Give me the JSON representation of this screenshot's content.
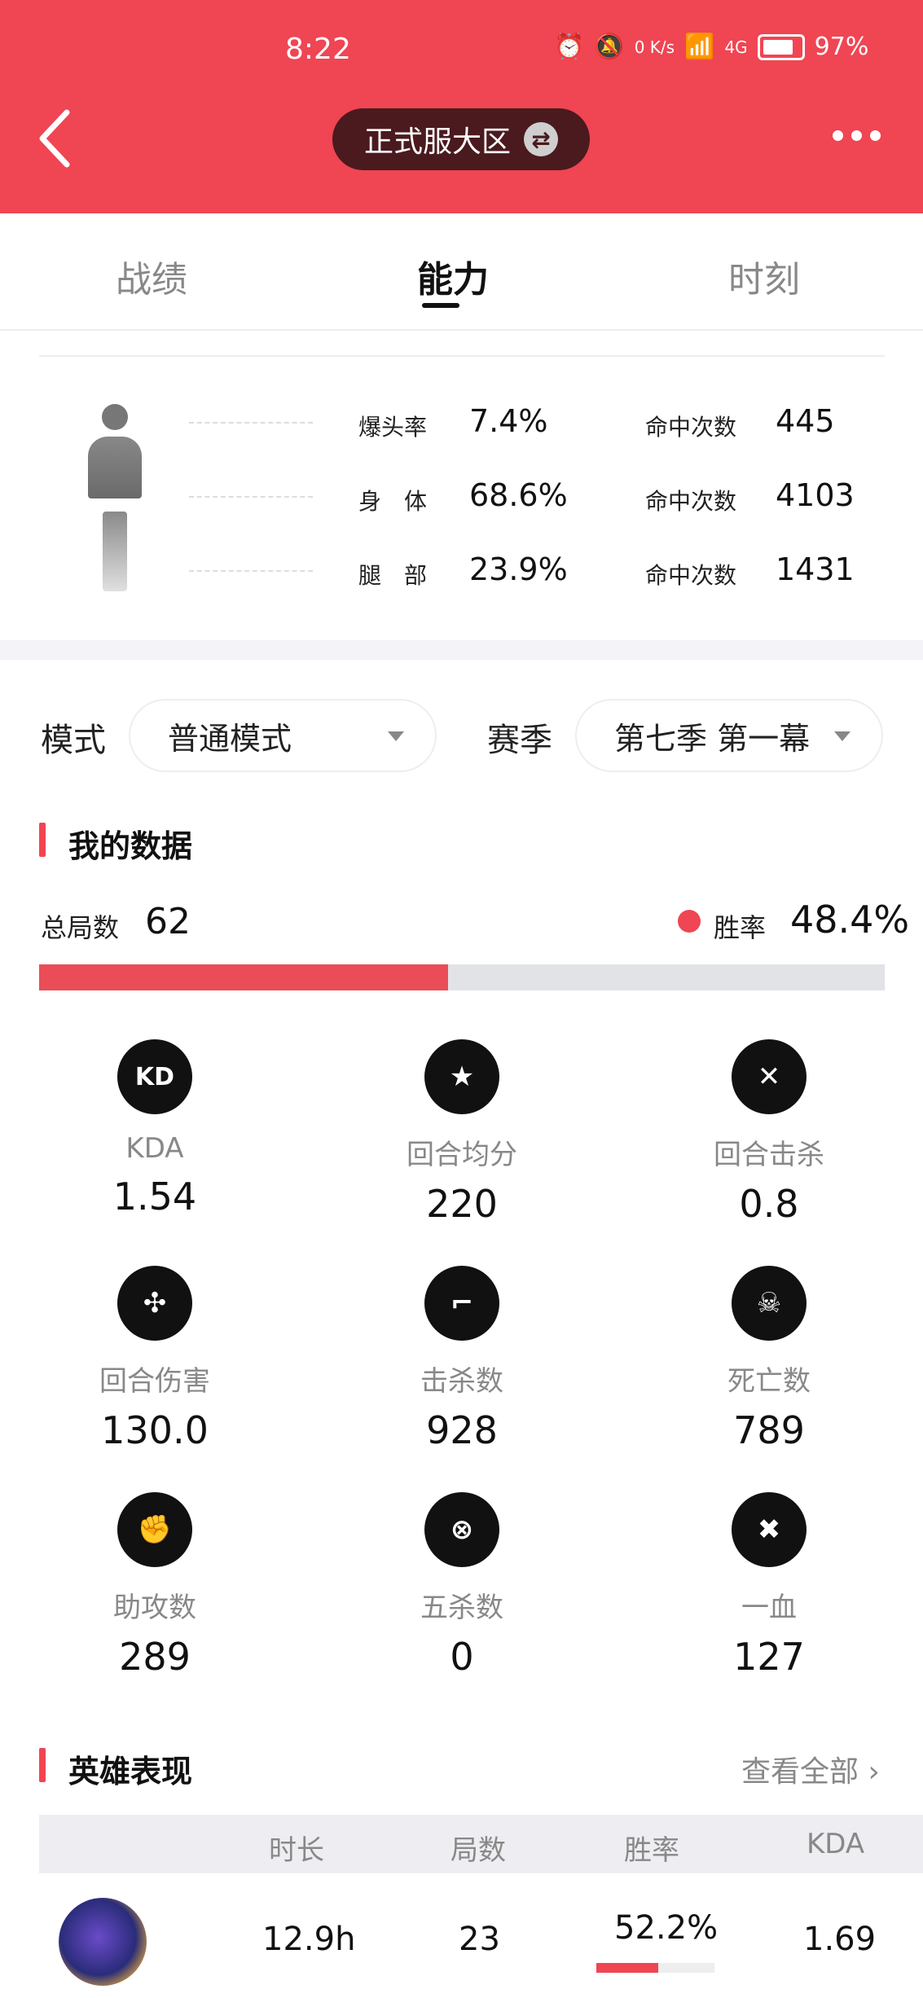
{
  "status_bar": {
    "time": "8:22",
    "speed": "0 K/s",
    "network": "4G",
    "battery": "97%"
  },
  "header": {
    "server_label": "正式服大区"
  },
  "tabs": [
    {
      "label": "战绩",
      "active": false
    },
    {
      "label": "能力",
      "active": true
    },
    {
      "label": "时刻",
      "active": false
    }
  ],
  "hit_stats": [
    {
      "part": "爆头率",
      "pct": "7.4%",
      "count_label": "命中次数",
      "count": "445"
    },
    {
      "part": "身　体",
      "pct": "68.6%",
      "count_label": "命中次数",
      "count": "4103"
    },
    {
      "part": "腿　部",
      "pct": "23.9%",
      "count_label": "命中次数",
      "count": "1431"
    }
  ],
  "filters": {
    "mode_label": "模式",
    "mode_value": "普通模式",
    "season_label": "赛季",
    "season_value": "第七季 第一幕"
  },
  "my_data": {
    "title": "我的数据",
    "total_label": "总局数",
    "total_value": "62",
    "winrate_label": "胜率",
    "winrate_value": "48.4%",
    "winrate_fraction": 0.484
  },
  "stats": [
    {
      "label": "KDA",
      "value": "1.54",
      "icon": "kd-icon",
      "glyph": "KD"
    },
    {
      "label": "回合均分",
      "value": "220",
      "icon": "star-badge-icon",
      "glyph": "★"
    },
    {
      "label": "回合击杀",
      "value": "0.8",
      "icon": "crossed-blades-icon",
      "glyph": "✕"
    },
    {
      "label": "回合伤害",
      "value": "130.0",
      "icon": "slash-icon",
      "glyph": "✣"
    },
    {
      "label": "击杀数",
      "value": "928",
      "icon": "pistol-icon",
      "glyph": "⌐"
    },
    {
      "label": "死亡数",
      "value": "789",
      "icon": "skull-icon",
      "glyph": "☠"
    },
    {
      "label": "助攻数",
      "value": "289",
      "icon": "fist-icon",
      "glyph": "✊"
    },
    {
      "label": "五杀数",
      "value": "0",
      "icon": "target-icon",
      "glyph": "⊗"
    },
    {
      "label": "一血",
      "value": "127",
      "icon": "blood-drop-icon",
      "glyph": "✖"
    }
  ],
  "hero_section": {
    "title": "英雄表现",
    "view_all": "查看全部",
    "columns": [
      "时长",
      "局数",
      "胜率",
      "KDA"
    ],
    "rows": [
      {
        "duration": "12.9h",
        "games": "23",
        "winrate": "52.2%",
        "winrate_fraction": 0.522,
        "kda": "1.69"
      }
    ]
  },
  "colors": {
    "accent": "#f04553",
    "header_bg": "#f04553",
    "pill_bg": "#4a1a1e"
  }
}
